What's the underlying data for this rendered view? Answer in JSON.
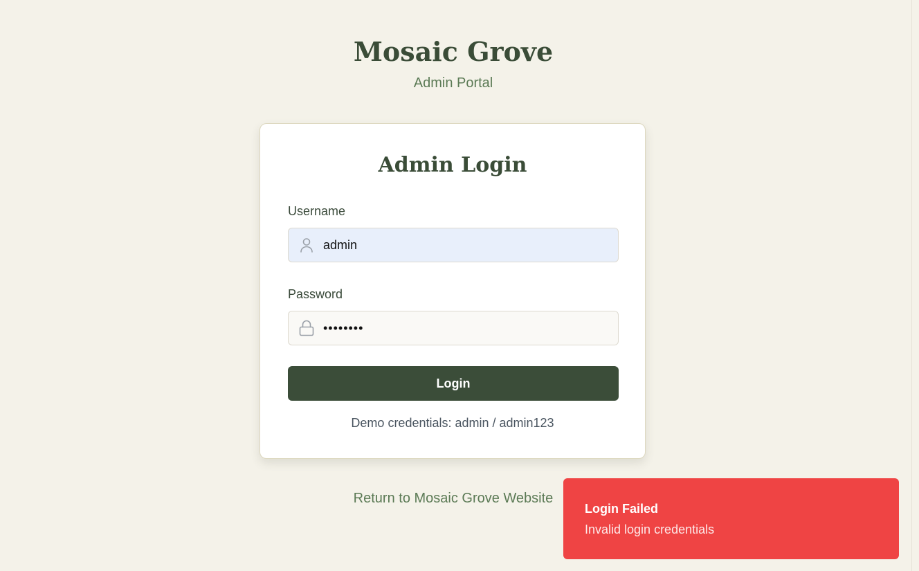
{
  "brand": {
    "title": "Mosaic Grove",
    "subtitle": "Admin Portal"
  },
  "login_form": {
    "title": "Admin Login",
    "username": {
      "label": "Username",
      "value": "admin",
      "icon": "user-icon"
    },
    "password": {
      "label": "Password",
      "masked_value": "••••••••",
      "icon": "lock-icon"
    },
    "submit_label": "Login",
    "demo_credentials": "Demo credentials: admin / admin123"
  },
  "footer": {
    "return_link": "Return to Mosaic Grove Website"
  },
  "toast": {
    "title": "Login Failed",
    "message": "Invalid login credentials",
    "color": "#ef4444"
  },
  "colors": {
    "background": "#f4f2e9",
    "primary": "#3b4d39",
    "accent_text": "#5b7a55"
  }
}
